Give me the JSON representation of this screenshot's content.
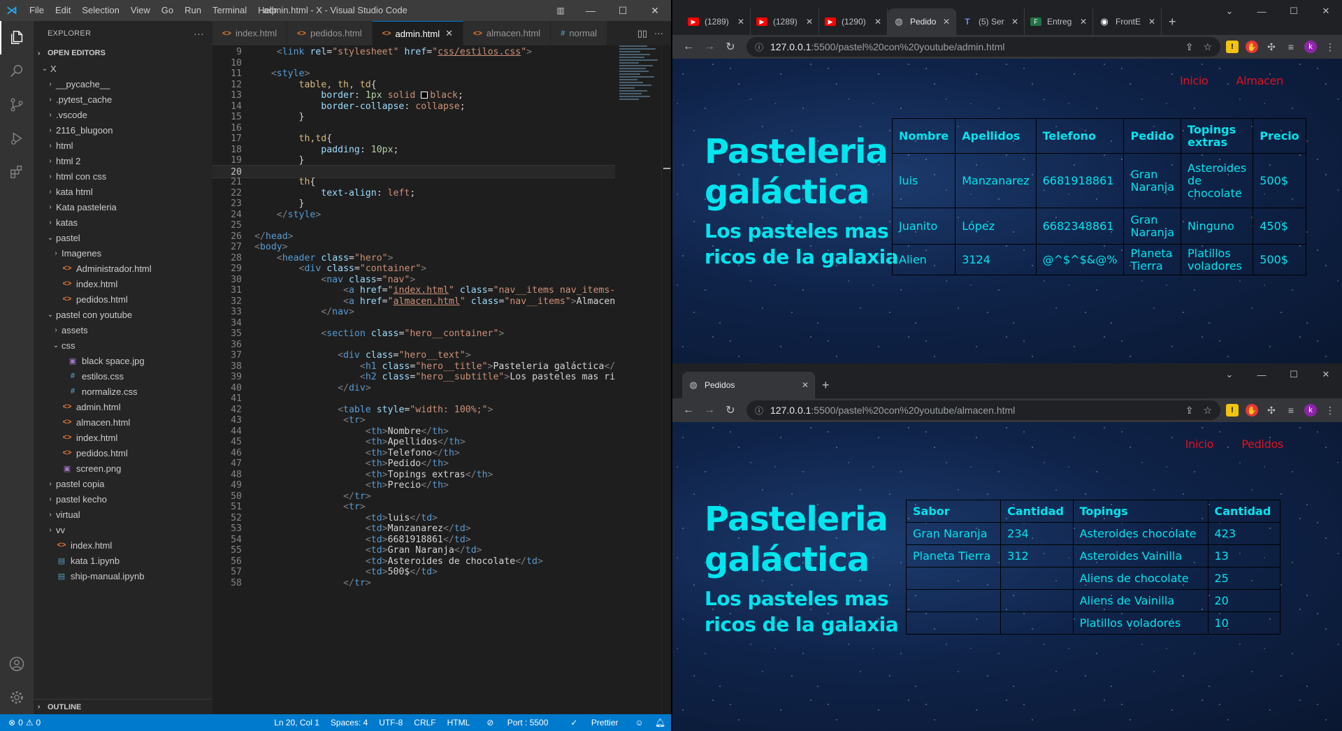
{
  "vscode": {
    "menu": [
      "File",
      "Edit",
      "Selection",
      "View",
      "Go",
      "Run",
      "Terminal",
      "Help"
    ],
    "window_title": "admin.html - X - Visual Studio Code",
    "explorer": {
      "header": "EXPLORER",
      "open_editors": "OPEN EDITORS",
      "tree": [
        {
          "label": "X",
          "type": "folder",
          "open": true,
          "depth": 0
        },
        {
          "label": "__pycache__",
          "type": "folder",
          "open": false,
          "depth": 1
        },
        {
          "label": ".pytest_cache",
          "type": "folder",
          "open": false,
          "depth": 1
        },
        {
          "label": ".vscode",
          "type": "folder",
          "open": false,
          "depth": 1
        },
        {
          "label": "2116_blugoon",
          "type": "folder",
          "open": false,
          "depth": 1
        },
        {
          "label": "html",
          "type": "folder",
          "open": false,
          "depth": 1
        },
        {
          "label": "html 2",
          "type": "folder",
          "open": false,
          "depth": 1
        },
        {
          "label": "html con css",
          "type": "folder",
          "open": false,
          "depth": 1
        },
        {
          "label": "kata html",
          "type": "folder",
          "open": false,
          "depth": 1
        },
        {
          "label": "Kata pasteleria",
          "type": "folder",
          "open": false,
          "depth": 1
        },
        {
          "label": "katas",
          "type": "folder",
          "open": false,
          "depth": 1
        },
        {
          "label": "pastel",
          "type": "folder",
          "open": true,
          "depth": 1
        },
        {
          "label": "Imagenes",
          "type": "folder",
          "open": false,
          "depth": 2
        },
        {
          "label": "Administrador.html",
          "type": "html",
          "depth": 2
        },
        {
          "label": "index.html",
          "type": "html",
          "depth": 2
        },
        {
          "label": "pedidos.html",
          "type": "html",
          "depth": 2
        },
        {
          "label": "pastel con youtube",
          "type": "folder",
          "open": true,
          "depth": 1
        },
        {
          "label": "assets",
          "type": "folder",
          "open": false,
          "depth": 2
        },
        {
          "label": "css",
          "type": "folder",
          "open": true,
          "depth": 2
        },
        {
          "label": "black space.jpg",
          "type": "img",
          "depth": 3
        },
        {
          "label": "estilos.css",
          "type": "css",
          "depth": 3
        },
        {
          "label": "normalize.css",
          "type": "css",
          "depth": 3
        },
        {
          "label": "admin.html",
          "type": "html",
          "depth": 2
        },
        {
          "label": "almacen.html",
          "type": "html",
          "depth": 2
        },
        {
          "label": "index.html",
          "type": "html",
          "depth": 2
        },
        {
          "label": "pedidos.html",
          "type": "html",
          "depth": 2
        },
        {
          "label": "screen.png",
          "type": "img",
          "depth": 2
        },
        {
          "label": "pastel copia",
          "type": "folder",
          "open": false,
          "depth": 1
        },
        {
          "label": "pastel kecho",
          "type": "folder",
          "open": false,
          "depth": 1
        },
        {
          "label": "virtual",
          "type": "folder",
          "open": false,
          "depth": 1
        },
        {
          "label": "vv",
          "type": "folder",
          "open": false,
          "depth": 1
        },
        {
          "label": "index.html",
          "type": "html",
          "depth": 1
        },
        {
          "label": "kata 1.ipynb",
          "type": "nb",
          "depth": 1
        },
        {
          "label": "ship-manual.ipynb",
          "type": "nb",
          "depth": 1
        }
      ],
      "outline": "OUTLINE"
    },
    "tabs": [
      {
        "label": "index.html",
        "active": false
      },
      {
        "label": "pedidos.html",
        "active": false
      },
      {
        "label": "admin.html",
        "active": true
      },
      {
        "label": "almacen.html",
        "active": false
      },
      {
        "label": "normal",
        "active": false,
        "css": true
      }
    ],
    "current_line": 20,
    "code_lines": [
      {
        "n": 9,
        "html": "    <span class='pu'>&lt;</span><span class='tg'>link</span> <span class='at'>rel</span><span class='tx'>=</span><span class='st'>\"stylesheet\"</span> <span class='at'>href</span><span class='tx'>=</span><span class='st'>\"<span class='ul'>css/estilos.css</span>\"</span><span class='pu'>&gt;</span>"
      },
      {
        "n": 10,
        "html": ""
      },
      {
        "n": 11,
        "html": "   <span class='pu'>&lt;</span><span class='tg'>style</span><span class='pu'>&gt;</span>"
      },
      {
        "n": 12,
        "html": "        <span class='sel'>table, th, td</span><span class='tx'>{</span>"
      },
      {
        "n": 13,
        "html": "            <span class='pr'>border</span><span class='tx'>: </span><span class='nm'>1px</span> <span class='vl'>solid</span> <span class='swatch'></span><span class='vl'>black</span><span class='tx'>;</span>"
      },
      {
        "n": 14,
        "html": "            <span class='pr'>border-collapse</span><span class='tx'>: </span><span class='vl'>collapse</span><span class='tx'>;</span>"
      },
      {
        "n": 15,
        "html": "        <span class='tx'>}</span>"
      },
      {
        "n": 16,
        "html": ""
      },
      {
        "n": 17,
        "html": "        <span class='sel'>th,td</span><span class='tx'>{</span>"
      },
      {
        "n": 18,
        "html": "            <span class='pr'>padding</span><span class='tx'>: </span><span class='nm'>10px</span><span class='tx'>;</span>"
      },
      {
        "n": 19,
        "html": "        <span class='tx'>}</span>"
      },
      {
        "n": 20,
        "html": ""
      },
      {
        "n": 21,
        "html": "        <span class='sel'>th</span><span class='tx'>{</span>"
      },
      {
        "n": 22,
        "html": "            <span class='pr'>text-align</span><span class='tx'>: </span><span class='vl'>left</span><span class='tx'>;</span>"
      },
      {
        "n": 23,
        "html": "        <span class='tx'>}</span>"
      },
      {
        "n": 24,
        "html": "    <span class='pu'>&lt;/</span><span class='tg'>style</span><span class='pu'>&gt;</span>"
      },
      {
        "n": 25,
        "html": ""
      },
      {
        "n": 26,
        "html": "<span class='pu'>&lt;/</span><span class='tg'>head</span><span class='pu'>&gt;</span>"
      },
      {
        "n": 27,
        "html": "<span class='pu'>&lt;</span><span class='tg'>body</span><span class='pu'>&gt;</span>"
      },
      {
        "n": 28,
        "html": "    <span class='pu'>&lt;</span><span class='tg'>header</span> <span class='at'>class</span><span class='tx'>=</span><span class='st'>\"hero\"</span><span class='pu'>&gt;</span>"
      },
      {
        "n": 29,
        "html": "        <span class='pu'>&lt;</span><span class='tg'>div</span> <span class='at'>class</span><span class='tx'>=</span><span class='st'>\"container\"</span><span class='pu'>&gt;</span>"
      },
      {
        "n": 30,
        "html": "            <span class='pu'>&lt;</span><span class='tg'>nav</span> <span class='at'>class</span><span class='tx'>=</span><span class='st'>\"nav\"</span><span class='pu'>&gt;</span>"
      },
      {
        "n": 31,
        "html": "                <span class='pu'>&lt;</span><span class='tg'>a</span> <span class='at'>href</span><span class='tx'>=</span><span class='st'>\"<span class='ul'>index.html</span>\"</span> <span class='at'>class</span><span class='tx'>=</span><span class='st'>\"nav__items nav_items-</span>"
      },
      {
        "n": 32,
        "html": "                <span class='pu'>&lt;</span><span class='tg'>a</span> <span class='at'>href</span><span class='tx'>=</span><span class='st'>\"<span class='ul'>almacen.html</span>\"</span> <span class='at'>class</span><span class='tx'>=</span><span class='st'>\"nav__items\"</span><span class='pu'>&gt;</span><span class='tx'>Almacen</span>"
      },
      {
        "n": 33,
        "html": "            <span class='pu'>&lt;/</span><span class='tg'>nav</span><span class='pu'>&gt;</span>"
      },
      {
        "n": 34,
        "html": ""
      },
      {
        "n": 35,
        "html": "            <span class='pu'>&lt;</span><span class='tg'>section</span> <span class='at'>class</span><span class='tx'>=</span><span class='st'>\"hero__container\"</span><span class='pu'>&gt;</span>"
      },
      {
        "n": 36,
        "html": ""
      },
      {
        "n": 37,
        "html": "               <span class='pu'>&lt;</span><span class='tg'>div</span> <span class='at'>class</span><span class='tx'>=</span><span class='st'>\"hero__text\"</span><span class='pu'>&gt;</span>"
      },
      {
        "n": 38,
        "html": "                   <span class='pu'>&lt;</span><span class='tg'>h1</span> <span class='at'>class</span><span class='tx'>=</span><span class='st'>\"hero__title\"</span><span class='pu'>&gt;</span><span class='tx'>Pasteleria galáctica</span><span class='pu'>&lt;/</span>"
      },
      {
        "n": 39,
        "html": "                   <span class='pu'>&lt;</span><span class='tg'>h2</span> <span class='at'>class</span><span class='tx'>=</span><span class='st'>\"hero__subtitle\"</span><span class='pu'>&gt;</span><span class='tx'>Los pasteles mas ri</span>"
      },
      {
        "n": 40,
        "html": "               <span class='pu'>&lt;/</span><span class='tg'>div</span><span class='pu'>&gt;</span>"
      },
      {
        "n": 41,
        "html": ""
      },
      {
        "n": 42,
        "html": "               <span class='pu'>&lt;</span><span class='tg'>table</span> <span class='at'>style</span><span class='tx'>=</span><span class='st'>\"width: 100%;\"</span><span class='pu'>&gt;</span>"
      },
      {
        "n": 43,
        "html": "                <span class='pu'>&lt;</span><span class='tg'>tr</span><span class='pu'>&gt;</span>"
      },
      {
        "n": 44,
        "html": "                    <span class='pu'>&lt;</span><span class='tg'>th</span><span class='pu'>&gt;</span><span class='tx'>Nombre</span><span class='pu'>&lt;/</span><span class='tg'>th</span><span class='pu'>&gt;</span>"
      },
      {
        "n": 45,
        "html": "                    <span class='pu'>&lt;</span><span class='tg'>th</span><span class='pu'>&gt;</span><span class='tx'>Apellidos</span><span class='pu'>&lt;/</span><span class='tg'>th</span><span class='pu'>&gt;</span>"
      },
      {
        "n": 46,
        "html": "                    <span class='pu'>&lt;</span><span class='tg'>th</span><span class='pu'>&gt;</span><span class='tx'>Telefono</span><span class='pu'>&lt;/</span><span class='tg'>th</span><span class='pu'>&gt;</span>"
      },
      {
        "n": 47,
        "html": "                    <span class='pu'>&lt;</span><span class='tg'>th</span><span class='pu'>&gt;</span><span class='tx'>Pedido</span><span class='pu'>&lt;/</span><span class='tg'>th</span><span class='pu'>&gt;</span>"
      },
      {
        "n": 48,
        "html": "                    <span class='pu'>&lt;</span><span class='tg'>th</span><span class='pu'>&gt;</span><span class='tx'>Topings extras</span><span class='pu'>&lt;/</span><span class='tg'>th</span><span class='pu'>&gt;</span>"
      },
      {
        "n": 49,
        "html": "                    <span class='pu'>&lt;</span><span class='tg'>th</span><span class='pu'>&gt;</span><span class='tx'>Precio</span><span class='pu'>&lt;/</span><span class='tg'>th</span><span class='pu'>&gt;</span>"
      },
      {
        "n": 50,
        "html": "                <span class='pu'>&lt;/</span><span class='tg'>tr</span><span class='pu'>&gt;</span>"
      },
      {
        "n": 51,
        "html": "                <span class='pu'>&lt;</span><span class='tg'>tr</span><span class='pu'>&gt;</span>"
      },
      {
        "n": 52,
        "html": "                    <span class='pu'>&lt;</span><span class='tg'>td</span><span class='pu'>&gt;</span><span class='tx'>luis</span><span class='pu'>&lt;/</span><span class='tg'>td</span><span class='pu'>&gt;</span>"
      },
      {
        "n": 53,
        "html": "                    <span class='pu'>&lt;</span><span class='tg'>td</span><span class='pu'>&gt;</span><span class='tx'>Manzanarez</span><span class='pu'>&lt;/</span><span class='tg'>td</span><span class='pu'>&gt;</span>"
      },
      {
        "n": 54,
        "html": "                    <span class='pu'>&lt;</span><span class='tg'>td</span><span class='pu'>&gt;</span><span class='tx'>6681918861</span><span class='pu'>&lt;/</span><span class='tg'>td</span><span class='pu'>&gt;</span>"
      },
      {
        "n": 55,
        "html": "                    <span class='pu'>&lt;</span><span class='tg'>td</span><span class='pu'>&gt;</span><span class='tx'>Gran Naranja</span><span class='pu'>&lt;/</span><span class='tg'>td</span><span class='pu'>&gt;</span>"
      },
      {
        "n": 56,
        "html": "                    <span class='pu'>&lt;</span><span class='tg'>td</span><span class='pu'>&gt;</span><span class='tx'>Asteroides de chocolate</span><span class='pu'>&lt;/</span><span class='tg'>td</span><span class='pu'>&gt;</span>"
      },
      {
        "n": 57,
        "html": "                    <span class='pu'>&lt;</span><span class='tg'>td</span><span class='pu'>&gt;</span><span class='tx'>500$</span><span class='pu'>&lt;/</span><span class='tg'>td</span><span class='pu'>&gt;</span>"
      },
      {
        "n": 58,
        "html": "                <span class='pu'>&lt;/</span><span class='tg'>tr</span><span class='pu'>&gt;</span>"
      }
    ],
    "status": {
      "errors": "0",
      "warnings": "0",
      "position": "Ln 20, Col 1",
      "spaces": "Spaces: 4",
      "encoding": "UTF-8",
      "eol": "CRLF",
      "language": "HTML",
      "port": "Port : 5500",
      "prettier": "Prettier"
    }
  },
  "browser1": {
    "tabs": [
      {
        "label": "(1289)",
        "icon": "yt"
      },
      {
        "label": "(1289)",
        "icon": "yt"
      },
      {
        "label": "(1290)",
        "icon": "yt"
      },
      {
        "label": "Pedido",
        "icon": "globe",
        "active": true
      },
      {
        "label": "(5) Ser",
        "icon": "teams"
      },
      {
        "label": "Entreg",
        "icon": "forms"
      },
      {
        "label": "FrontE",
        "icon": "gh"
      }
    ],
    "url_host": "127.0.0.1",
    "url_path": ":5500/pastel%20con%20youtube/admin.html",
    "avatar": "k",
    "page": {
      "nav": [
        "Inicio",
        "Almacen"
      ],
      "title": "Pasteleria galáctica",
      "subtitle": "Los pasteles mas ricos de la galaxia",
      "table": {
        "headers": [
          "Nombre",
          "Apellidos",
          "Telefono",
          "Pedido",
          "Topings extras",
          "Precio"
        ],
        "rows": [
          [
            "luis",
            "Manzanarez",
            "6681918861",
            "Gran Naranja",
            "Asteroides de chocolate",
            "500$"
          ],
          [
            "Juanito",
            "López",
            "6682348861",
            "Gran Naranja",
            "Ninguno",
            "450$"
          ],
          [
            "Alien",
            "3124",
            "@^$^$&@%",
            "Planeta Tierra",
            "Platillos voladores",
            "500$"
          ]
        ]
      }
    }
  },
  "browser2": {
    "tabs": [
      {
        "label": "Pedidos",
        "icon": "globe",
        "active": true
      }
    ],
    "url_host": "127.0.0.1",
    "url_path": ":5500/pastel%20con%20youtube/almacen.html",
    "avatar": "k",
    "page": {
      "nav": [
        "Inicio",
        "Pedidos"
      ],
      "title": "Pasteleria galáctica",
      "subtitle": "Los pasteles mas ricos de la galaxia",
      "table": {
        "headers": [
          "Sabor",
          "Cantidad",
          "Topings",
          "Cantidad"
        ],
        "rows": [
          [
            "Gran Naranja",
            "234",
            "Asteroides chocolate",
            "423"
          ],
          [
            "Planeta Tierra",
            "312",
            "Asteroides Vainilla",
            "13"
          ],
          [
            "",
            "",
            "Aliens de chocolate",
            "25"
          ],
          [
            "",
            "",
            "Aliens de Vainilla",
            "20"
          ],
          [
            "",
            "",
            "Platillos voladores",
            "10"
          ]
        ]
      }
    }
  }
}
